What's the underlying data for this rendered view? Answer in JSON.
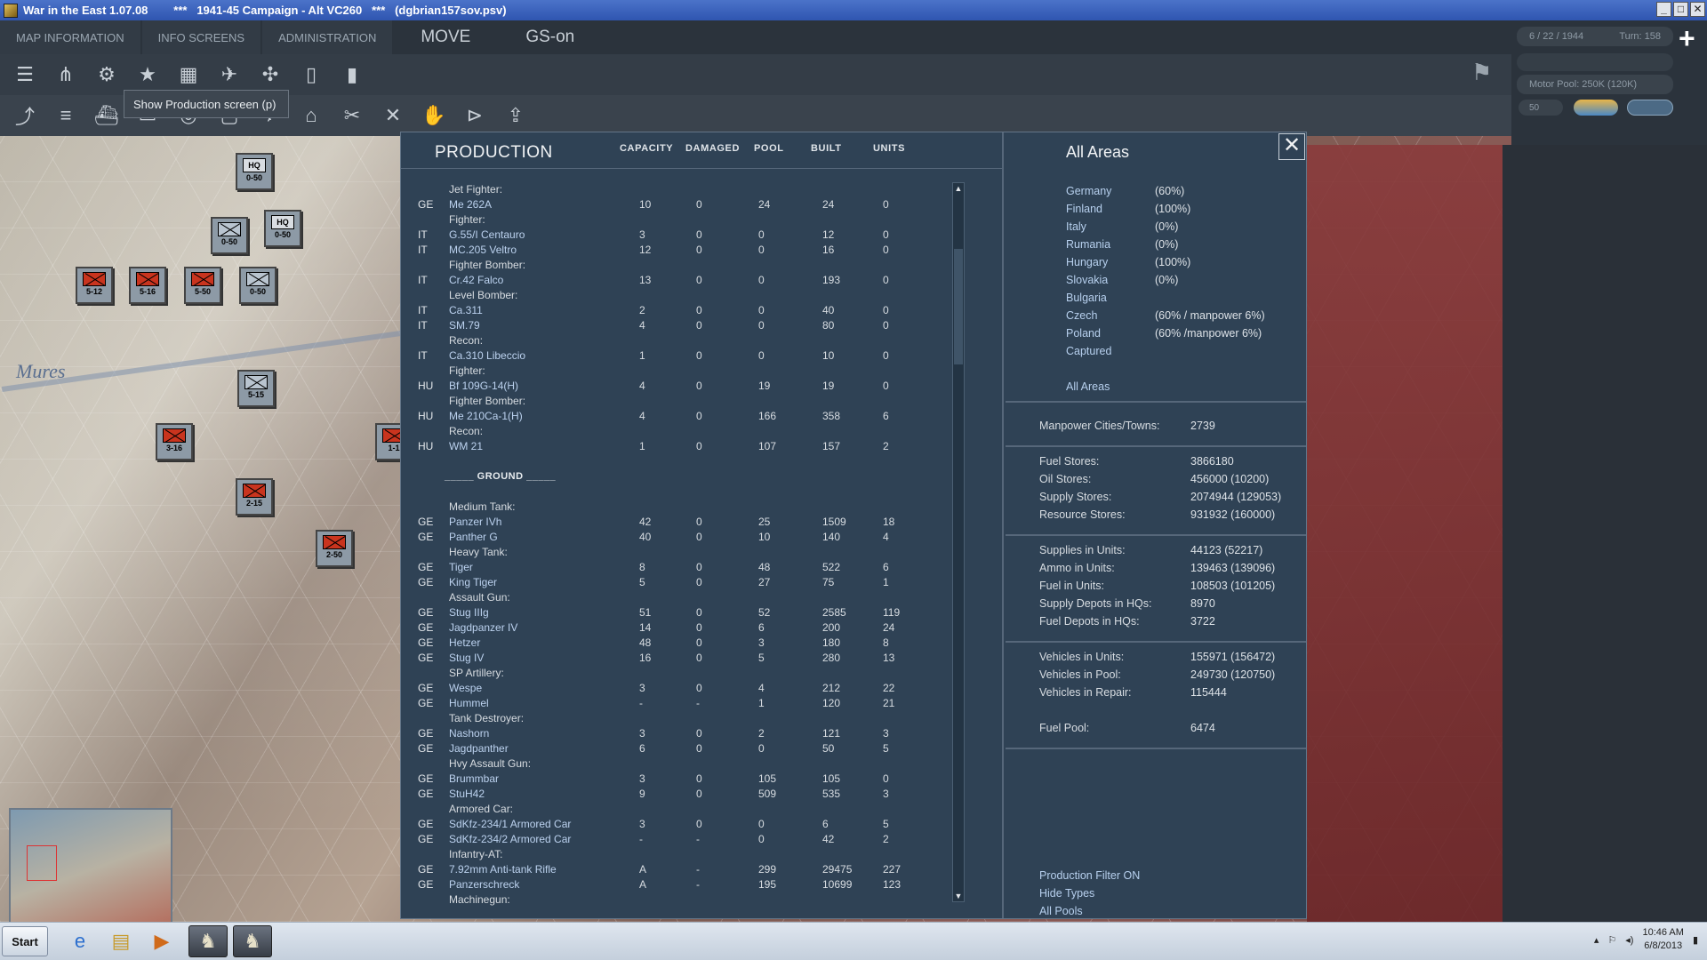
{
  "window": {
    "title": "War in the East 1.07.08        ***   1941-45 Campaign - Alt VC260   ***   (dgbrian157sov.psv)",
    "btn_min": "_",
    "btn_max": "□",
    "btn_close": "✕"
  },
  "menu": {
    "map_info": "MAP INFORMATION",
    "info_screens": "INFO SCREENS",
    "administration": "ADMINISTRATION",
    "mode": "MOVE",
    "gs": "GS-on"
  },
  "tooltip": "Show Production screen (p)",
  "status": {
    "date": "6 / 22 / 1944",
    "turn": "Turn: 158",
    "motor_pool": "Motor Pool:  250K (120K)",
    "fifty": "50"
  },
  "map": {
    "river_label": "Mures"
  },
  "counters": [
    {
      "label": "0-50",
      "type": "hq",
      "hq": "HQ"
    },
    {
      "label": "0-50",
      "type": "hq",
      "hq": "HQ"
    },
    {
      "label": "0-50",
      "type": "unit"
    },
    {
      "label": "5-12",
      "type": "red"
    },
    {
      "label": "5-16",
      "type": "red"
    },
    {
      "label": "5-50",
      "type": "red"
    },
    {
      "label": "0-50",
      "type": "unit"
    },
    {
      "label": "5-15",
      "type": "unit"
    },
    {
      "label": "3-16",
      "type": "red"
    },
    {
      "label": "2-15",
      "type": "red"
    },
    {
      "label": "2-50",
      "type": "red"
    },
    {
      "label": "1-1",
      "type": "red"
    }
  ],
  "production": {
    "title": "PRODUCTION",
    "headers": {
      "capacity": "CAPACITY",
      "damaged": "DAMAGED",
      "pool": "POOL",
      "built": "BUILT",
      "units": "UNITS"
    },
    "rows": [
      {
        "t": "cat",
        "name": "Jet Fighter:"
      },
      {
        "t": "item",
        "nat": "GE",
        "name": "Me 262A",
        "cap": "10",
        "dam": "0",
        "pool": "24",
        "built": "24",
        "units": "0"
      },
      {
        "t": "cat",
        "name": "Fighter:"
      },
      {
        "t": "item",
        "nat": "IT",
        "name": "G.55/I Centauro",
        "cap": "3",
        "dam": "0",
        "pool": "0",
        "built": "12",
        "units": "0"
      },
      {
        "t": "item",
        "nat": "IT",
        "name": "MC.205 Veltro",
        "cap": "12",
        "dam": "0",
        "pool": "0",
        "built": "16",
        "units": "0"
      },
      {
        "t": "cat",
        "name": "Fighter Bomber:"
      },
      {
        "t": "item",
        "nat": "IT",
        "name": "Cr.42 Falco",
        "cap": "13",
        "dam": "0",
        "pool": "0",
        "built": "193",
        "units": "0"
      },
      {
        "t": "cat",
        "name": "Level Bomber:"
      },
      {
        "t": "item",
        "nat": "IT",
        "name": "Ca.311",
        "cap": "2",
        "dam": "0",
        "pool": "0",
        "built": "40",
        "units": "0"
      },
      {
        "t": "item",
        "nat": "IT",
        "name": "SM.79",
        "cap": "4",
        "dam": "0",
        "pool": "0",
        "built": "80",
        "units": "0"
      },
      {
        "t": "cat",
        "name": "Recon:"
      },
      {
        "t": "item",
        "nat": "IT",
        "name": "Ca.310 Libeccio",
        "cap": "1",
        "dam": "0",
        "pool": "0",
        "built": "10",
        "units": "0"
      },
      {
        "t": "cat",
        "name": "Fighter:"
      },
      {
        "t": "item",
        "nat": "HU",
        "name": "Bf 109G-14(H)",
        "cap": "4",
        "dam": "0",
        "pool": "19",
        "built": "19",
        "units": "0"
      },
      {
        "t": "cat",
        "name": "Fighter Bomber:"
      },
      {
        "t": "item",
        "nat": "HU",
        "name": "Me 210Ca-1(H)",
        "cap": "4",
        "dam": "0",
        "pool": "166",
        "built": "358",
        "units": "6"
      },
      {
        "t": "cat",
        "name": "Recon:"
      },
      {
        "t": "item",
        "nat": "HU",
        "name": "WM 21",
        "cap": "1",
        "dam": "0",
        "pool": "107",
        "built": "157",
        "units": "2"
      },
      {
        "t": "blank"
      },
      {
        "t": "sec",
        "name": "_____ GROUND _____"
      },
      {
        "t": "blank"
      },
      {
        "t": "cat",
        "name": "Medium Tank:"
      },
      {
        "t": "item",
        "nat": "GE",
        "name": "Panzer IVh",
        "cap": "42",
        "dam": "0",
        "pool": "25",
        "built": "1509",
        "units": "18"
      },
      {
        "t": "item",
        "nat": "GE",
        "name": "Panther G",
        "cap": "40",
        "dam": "0",
        "pool": "10",
        "built": "140",
        "units": "4"
      },
      {
        "t": "cat",
        "name": "Heavy Tank:"
      },
      {
        "t": "item",
        "nat": "GE",
        "name": "Tiger",
        "cap": "8",
        "dam": "0",
        "pool": "48",
        "built": "522",
        "units": "6"
      },
      {
        "t": "item",
        "nat": "GE",
        "name": "King Tiger",
        "cap": "5",
        "dam": "0",
        "pool": "27",
        "built": "75",
        "units": "1"
      },
      {
        "t": "cat",
        "name": "Assault Gun:"
      },
      {
        "t": "item",
        "nat": "GE",
        "name": "Stug IIIg",
        "cap": "51",
        "dam": "0",
        "pool": "52",
        "built": "2585",
        "units": "119"
      },
      {
        "t": "item",
        "nat": "GE",
        "name": "Jagdpanzer IV",
        "cap": "14",
        "dam": "0",
        "pool": "6",
        "built": "200",
        "units": "24"
      },
      {
        "t": "item",
        "nat": "GE",
        "name": "Hetzer",
        "cap": "48",
        "dam": "0",
        "pool": "3",
        "built": "180",
        "units": "8"
      },
      {
        "t": "item",
        "nat": "GE",
        "name": "Stug IV",
        "cap": "16",
        "dam": "0",
        "pool": "5",
        "built": "280",
        "units": "13"
      },
      {
        "t": "cat",
        "name": "SP Artillery:"
      },
      {
        "t": "item",
        "nat": "GE",
        "name": "Wespe",
        "cap": "3",
        "dam": "0",
        "pool": "4",
        "built": "212",
        "units": "22"
      },
      {
        "t": "item",
        "nat": "GE",
        "name": "Hummel",
        "cap": "-",
        "dam": "-",
        "pool": "1",
        "built": "120",
        "units": "21"
      },
      {
        "t": "cat",
        "name": "Tank Destroyer:"
      },
      {
        "t": "item",
        "nat": "GE",
        "name": "Nashorn",
        "cap": "3",
        "dam": "0",
        "pool": "2",
        "built": "121",
        "units": "3"
      },
      {
        "t": "item",
        "nat": "GE",
        "name": "Jagdpanther",
        "cap": "6",
        "dam": "0",
        "pool": "0",
        "built": "50",
        "units": "5"
      },
      {
        "t": "cat",
        "name": "Hvy Assault Gun:"
      },
      {
        "t": "item",
        "nat": "GE",
        "name": "Brummbar",
        "cap": "3",
        "dam": "0",
        "pool": "105",
        "built": "105",
        "units": "0"
      },
      {
        "t": "item",
        "nat": "GE",
        "name": "StuH42",
        "cap": "9",
        "dam": "0",
        "pool": "509",
        "built": "535",
        "units": "3"
      },
      {
        "t": "cat",
        "name": "Armored Car:"
      },
      {
        "t": "item",
        "nat": "GE",
        "name": "SdKfz-234/1 Armored Car",
        "cap": "3",
        "dam": "0",
        "pool": "0",
        "built": "6",
        "units": "5"
      },
      {
        "t": "item",
        "nat": "GE",
        "name": "SdKfz-234/2 Armored Car",
        "cap": "-",
        "dam": "-",
        "pool": "0",
        "built": "42",
        "units": "2"
      },
      {
        "t": "cat",
        "name": "Infantry-AT:"
      },
      {
        "t": "item",
        "nat": "GE",
        "name": "7.92mm Anti-tank Rifle",
        "cap": "A",
        "dam": "-",
        "pool": "299",
        "built": "29475",
        "units": "227"
      },
      {
        "t": "item",
        "nat": "GE",
        "name": "Panzerschreck",
        "cap": "A",
        "dam": "-",
        "pool": "195",
        "built": "10699",
        "units": "123"
      },
      {
        "t": "cat",
        "name": "Machinegun:"
      }
    ]
  },
  "areas": {
    "title": "All Areas",
    "list": [
      {
        "name": "Germany",
        "value": "(60%)"
      },
      {
        "name": "Finland",
        "value": "(100%)"
      },
      {
        "name": "Italy",
        "value": "(0%)"
      },
      {
        "name": "Rumania",
        "value": "(0%)"
      },
      {
        "name": "Hungary",
        "value": "(100%)"
      },
      {
        "name": "Slovakia",
        "value": "(0%)"
      },
      {
        "name": "Bulgaria",
        "value": ""
      },
      {
        "name": "Czech",
        "value": "(60% / manpower 6%)"
      },
      {
        "name": "Poland",
        "value": "(60% /manpower 6%)"
      },
      {
        "name": "Captured",
        "value": ""
      },
      {
        "name": "",
        "value": ""
      },
      {
        "name": "All Areas",
        "value": ""
      }
    ],
    "manpower": [
      {
        "name": "Manpower Cities/Towns:",
        "value": "2739"
      }
    ],
    "stores": [
      {
        "name": "Fuel Stores:",
        "value": "3866180"
      },
      {
        "name": "Oil Stores:",
        "value": "456000 (10200)"
      },
      {
        "name": "Supply Stores:",
        "value": "2074944 (129053)"
      },
      {
        "name": "Resource Stores:",
        "value": "931932 (160000)"
      }
    ],
    "units": [
      {
        "name": "Supplies in Units:",
        "value": "44123 (52217)"
      },
      {
        "name": "Ammo in Units:",
        "value": "139463 (139096)"
      },
      {
        "name": "Fuel in Units:",
        "value": "108503 (101205)"
      },
      {
        "name": "Supply Depots in HQs:",
        "value": "8970"
      },
      {
        "name": "Fuel Depots in HQs:",
        "value": "3722"
      }
    ],
    "vehicles": [
      {
        "name": "Vehicles in Units:",
        "value": "155971 (156472)"
      },
      {
        "name": "Vehicles in Pool:",
        "value": "249730 (120750)"
      },
      {
        "name": "Vehicles in Repair:",
        "value": "115444"
      },
      {
        "name": "",
        "value": ""
      },
      {
        "name": "Fuel Pool:",
        "value": "6474"
      }
    ],
    "links": [
      "Production Filter ON",
      "Hide Types",
      "All Pools"
    ],
    "close": "✕"
  },
  "taskbar": {
    "start": "Start",
    "time": "10:46 AM",
    "date": "6/8/2013"
  }
}
